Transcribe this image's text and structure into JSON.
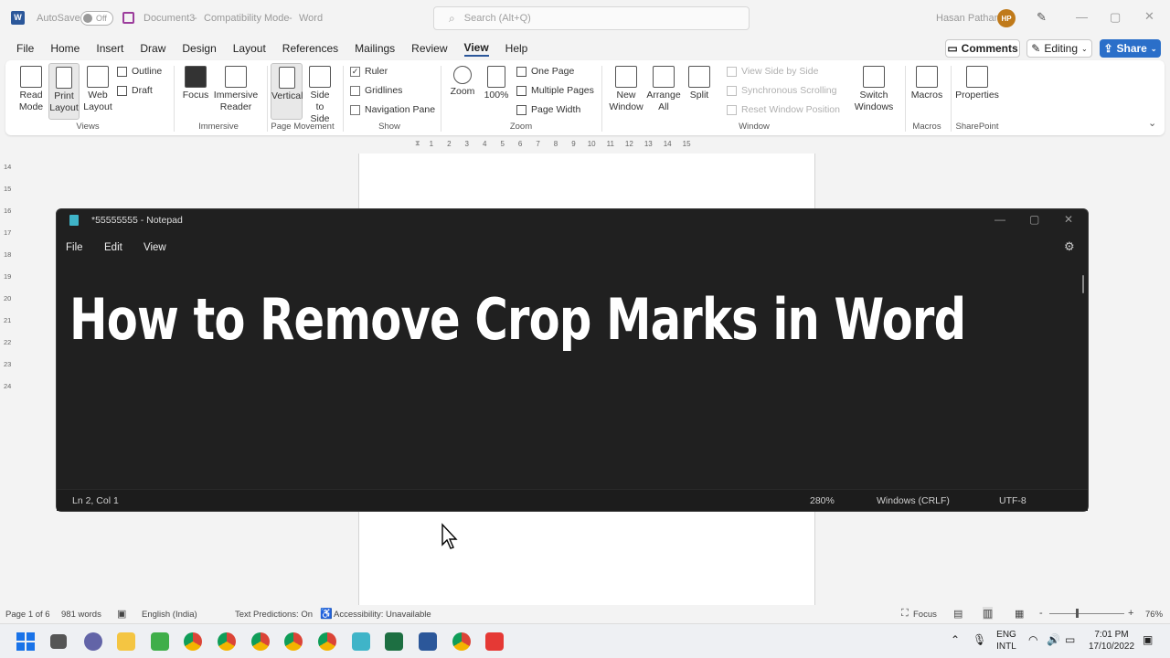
{
  "titlebar": {
    "autosave_label": "AutoSave",
    "autosave_state": "Off",
    "doc_name": "Document3",
    "mode": "Compatibility Mode",
    "separator": "-",
    "app": "Word",
    "search_placeholder": "Search (Alt+Q)",
    "user_name": "Hasan Pathan",
    "user_initials": "HP"
  },
  "tabs": [
    "File",
    "Home",
    "Insert",
    "Draw",
    "Design",
    "Layout",
    "References",
    "Mailings",
    "Review",
    "View",
    "Help"
  ],
  "active_tab": "View",
  "actions": {
    "comments": "Comments",
    "editing": "Editing",
    "share": "Share"
  },
  "ribbon": {
    "views": {
      "read_mode": "Read Mode",
      "print_layout": "Print Layout",
      "web_layout": "Web Layout",
      "outline": "Outline",
      "draft": "Draft",
      "group": "Views"
    },
    "immersive": {
      "focus": "Focus",
      "immersive_reader": "Immersive Reader",
      "group": "Immersive"
    },
    "page_movement": {
      "vertical": "Vertical",
      "side_to_side": "Side to Side",
      "group": "Page Movement"
    },
    "show": {
      "ruler": "Ruler",
      "gridlines": "Gridlines",
      "navigation_pane": "Navigation Pane",
      "group": "Show",
      "ruler_checked": true
    },
    "zoom": {
      "zoom": "Zoom",
      "hundred": "100%",
      "one_page": "One Page",
      "multiple_pages": "Multiple Pages",
      "page_width": "Page Width",
      "group": "Zoom"
    },
    "window": {
      "new_window": "New Window",
      "arrange_all": "Arrange All",
      "split": "Split",
      "view_side_by_side": "View Side by Side",
      "sync_scrolling": "Synchronous Scrolling",
      "reset_window": "Reset Window Position",
      "switch_windows": "Switch Windows",
      "group": "Window"
    },
    "macros": {
      "macros": "Macros",
      "group": "Macros"
    },
    "sharepoint": {
      "properties": "Properties",
      "group": "SharePoint"
    }
  },
  "ruler_marks": [
    "1",
    "2",
    "3",
    "4",
    "5",
    "6",
    "7",
    "8",
    "9",
    "10",
    "11",
    "12",
    "13",
    "14",
    "15"
  ],
  "vruler_marks": [
    "14",
    "15",
    "16",
    "17",
    "18",
    "19",
    "20",
    "21",
    "22",
    "23",
    "24"
  ],
  "notepad": {
    "title": "*55555555 - Notepad",
    "menu": [
      "File",
      "Edit",
      "View"
    ],
    "content": "How to Remove Crop Marks in Word",
    "status": {
      "position": "Ln 2, Col 1",
      "zoom": "280%",
      "line_ending": "Windows (CRLF)",
      "encoding": "UTF-8"
    }
  },
  "statusbar": {
    "page": "Page 1 of 6",
    "words": "981 words",
    "language": "English (India)",
    "text_predictions": "Text Predictions: On",
    "accessibility": "Accessibility: Unavailable",
    "focus": "Focus",
    "zoom": "76%",
    "minus": "-",
    "plus": "+"
  },
  "taskbar": {
    "lang_top": "ENG",
    "lang_bottom": "INTL",
    "time": "7:01 PM",
    "date": "17/10/2022"
  }
}
